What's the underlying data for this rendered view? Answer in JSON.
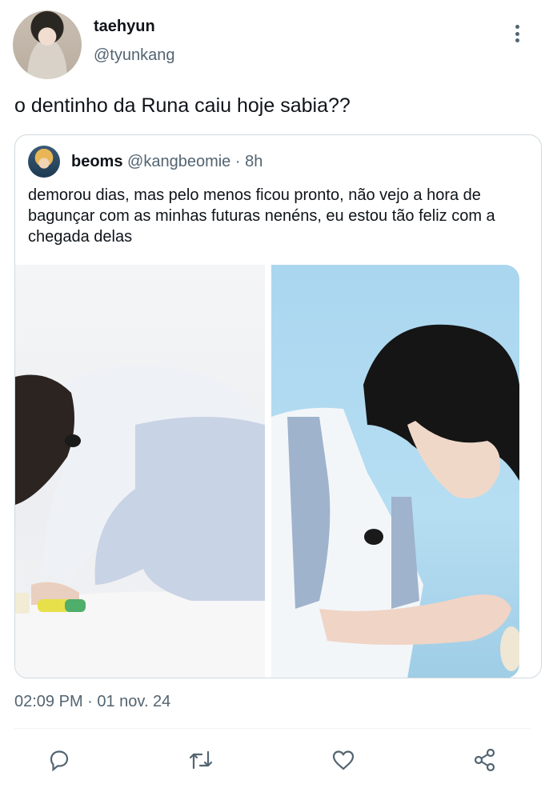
{
  "author": {
    "name": "taehyun",
    "handle": "@tyunkang"
  },
  "tweet": {
    "text": "o dentinho da Runa caiu hoje sabia??",
    "timestamp": "02:09 PM · 01 nov. 24"
  },
  "quoted": {
    "name": "beoms",
    "handle": "@kangbeomie",
    "separator": " · ",
    "time": "8h",
    "text": "demorou dias, mas pelo menos ficou pronto, não vejo a hora de bagunçar com as minhas futuras nenéns, eu estou tão feliz com a chegada delas"
  },
  "icons": {
    "more": "more-vertical-icon",
    "reply": "reply-icon",
    "retweet": "retweet-icon",
    "like": "heart-icon",
    "share": "share-icon"
  },
  "colors": {
    "muted": "#536471",
    "border": "#cfd9de",
    "icon": "#536471"
  }
}
